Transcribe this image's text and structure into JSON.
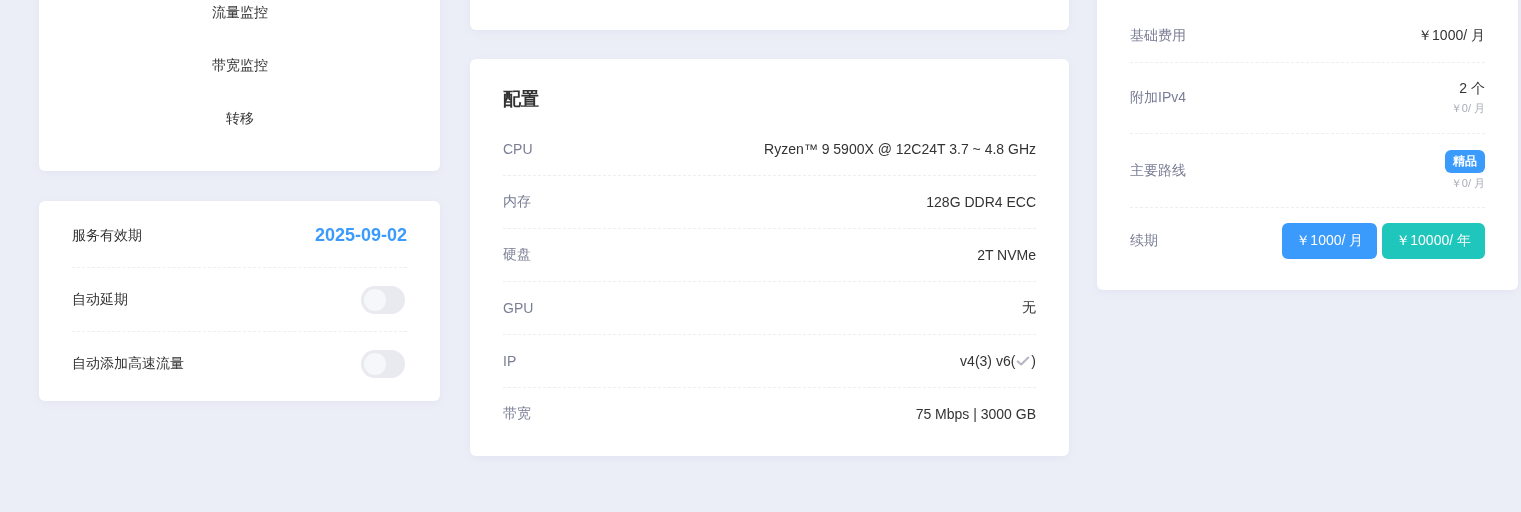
{
  "menu": [
    {
      "label": "流量监控"
    },
    {
      "label": "带宽监控"
    },
    {
      "label": "转移"
    }
  ],
  "service": {
    "expiry_label": "服务有效期",
    "expiry_date": "2025-09-02",
    "toggles": [
      {
        "label": "自动延期",
        "on": false
      },
      {
        "label": "自动添加高速流量",
        "on": false
      }
    ]
  },
  "config": {
    "title": "配置",
    "rows": [
      {
        "label": "CPU",
        "value": "Ryzen™ 9 5900X @ 12C24T 3.7 ~ 4.8 GHz"
      },
      {
        "label": "内存",
        "value": "128G DDR4 ECC"
      },
      {
        "label": "硬盘",
        "value": "2T NVMe"
      },
      {
        "label": "GPU",
        "value": "无"
      },
      {
        "label": "IP",
        "value": "v4(3) v6(",
        "ipv6_check": true,
        "suffix": ")"
      },
      {
        "label": "带宽",
        "value": "75 Mbps | 3000 GB"
      }
    ]
  },
  "pricing": [
    {
      "kind": "text",
      "label": "基础费用",
      "value": "￥1000/ 月"
    },
    {
      "kind": "sub",
      "label": "附加IPv4",
      "value": "2 个",
      "sub": "￥0/ 月"
    },
    {
      "kind": "badge",
      "label": "主要路线",
      "badge": "精品",
      "sub": "￥0/ 月"
    },
    {
      "kind": "buttons",
      "label": "续期",
      "buttons": [
        {
          "label": "￥1000/ 月",
          "color": "#3a9bfc"
        },
        {
          "label": "￥10000/ 年",
          "color": "#1fc6bb"
        }
      ]
    }
  ]
}
